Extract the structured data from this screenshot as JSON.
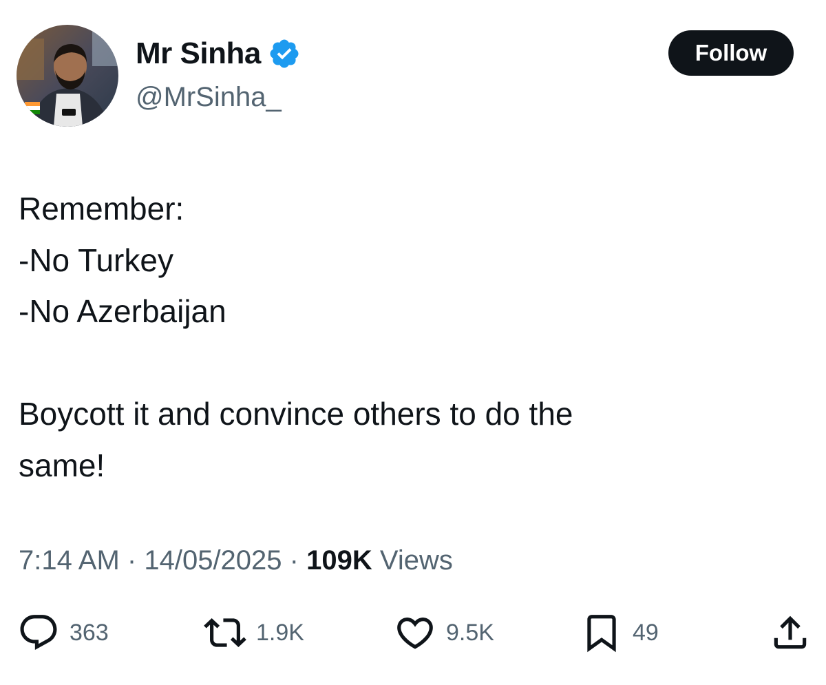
{
  "user": {
    "display_name": "Mr Sinha",
    "handle": "@MrSinha_",
    "verified": true,
    "verified_badge_color": "#1d9bf0"
  },
  "follow_label": "Follow",
  "tweet": {
    "lines": [
      "Remember:",
      "-No Turkey",
      "-No Azerbaijan",
      "",
      "Boycott it and convince others to do the",
      "same!"
    ]
  },
  "meta": {
    "time": "7:14 AM",
    "separator": "·",
    "date": "14/05/2025",
    "views_count": "109K",
    "views_label": "Views"
  },
  "actions": {
    "replies": {
      "icon": "reply-icon",
      "count": "363"
    },
    "reposts": {
      "icon": "repost-icon",
      "count": "1.9K"
    },
    "likes": {
      "icon": "heart-icon",
      "count": "9.5K"
    },
    "bookmarks": {
      "icon": "bookmark-icon",
      "count": "49"
    },
    "share": {
      "icon": "share-icon"
    }
  },
  "colors": {
    "text": "#0f1419",
    "secondary": "#536471",
    "follow_bg": "#0f1419",
    "verified": "#1d9bf0"
  }
}
